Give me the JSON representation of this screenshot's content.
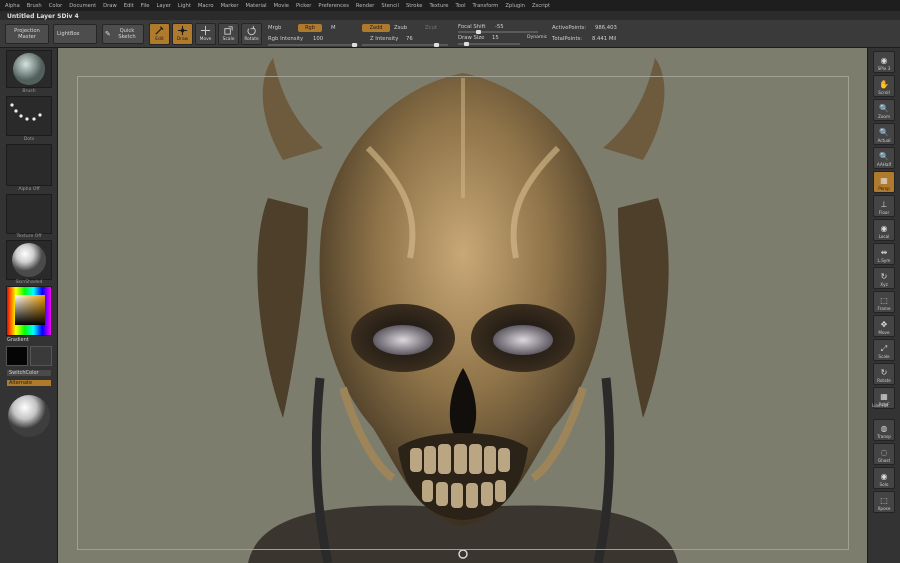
{
  "menu": [
    "Alpha",
    "Brush",
    "Color",
    "Document",
    "Draw",
    "Edit",
    "File",
    "Layer",
    "Light",
    "Macro",
    "Marker",
    "Material",
    "Movie",
    "Picker",
    "Preferences",
    "Render",
    "Stencil",
    "Stroke",
    "Texture",
    "Tool",
    "Transform",
    "Zplugin",
    "Zscript"
  ],
  "document": {
    "title": "Untitled Layer SDiv 4"
  },
  "shelf": {
    "projection_master": "Projection Master",
    "lightbox": "LightBox",
    "quick_sketch": "Quick Sketch",
    "edit": "Edit",
    "draw": "Draw",
    "move": "Move",
    "scale": "Scale",
    "rotate": "Rotate",
    "mrgb": "Mrgb",
    "rgb": "Rgb",
    "m": "M",
    "rgb_intensity_label": "Rgb Intensity",
    "rgb_intensity_value": "100",
    "zadd": "Zadd",
    "zsub": "Zsub",
    "zcut": "Zcut",
    "z_intensity_label": "Z Intensity",
    "z_intensity_value": "76",
    "focal_shift_label": "Focal Shift",
    "focal_shift_value": "-55",
    "draw_size_label": "Draw Size",
    "draw_size_value": "15",
    "dynamic": "Dynamic",
    "active_points_label": "ActivePoints:",
    "active_points_value": "986,403",
    "total_points_label": "TotalPoints:",
    "total_points_value": "8.441 Mil"
  },
  "left_tray": {
    "brush_label": "Brush",
    "stroke_label": "Dots",
    "alpha_label": "Alpha Off",
    "texture_label": "Texture Off",
    "material_label": "SkinShade4",
    "gradient_label": "Gradient",
    "switch_color_label": "SwitchColor",
    "alternate_label": "Alternate"
  },
  "right_tray": [
    {
      "label": "SPix 3",
      "glyph": "◉"
    },
    {
      "label": "Scroll",
      "glyph": "✋"
    },
    {
      "label": "Zoom",
      "glyph": "🔍"
    },
    {
      "label": "Actual",
      "glyph": "🔍"
    },
    {
      "label": "AAHalf",
      "glyph": "🔍"
    },
    {
      "label": "Persp",
      "glyph": "▦"
    },
    {
      "label": "Floor",
      "glyph": "⊥"
    },
    {
      "label": "Local",
      "glyph": "◉"
    },
    {
      "label": "L.Sym",
      "glyph": "⇹"
    },
    {
      "label": "Xyz",
      "glyph": "↻"
    },
    {
      "label": "Frame",
      "glyph": "⬚"
    },
    {
      "label": "Move",
      "glyph": "✥"
    },
    {
      "label": "Scale",
      "glyph": "⤢"
    },
    {
      "label": "Rotate",
      "glyph": "↻"
    },
    {
      "label": "PolyF",
      "glyph": "▦"
    },
    {
      "label": "Transp",
      "glyph": "◍"
    },
    {
      "label": "Ghost",
      "glyph": "◌"
    },
    {
      "label": "Solo",
      "glyph": "◉"
    },
    {
      "label": "Xpose",
      "glyph": "⬚"
    }
  ],
  "right_tray_extra": "Line Fill",
  "colors": {
    "accent": "#b07a2c",
    "canvas": "#7d7d6e",
    "panel": "#333333"
  }
}
